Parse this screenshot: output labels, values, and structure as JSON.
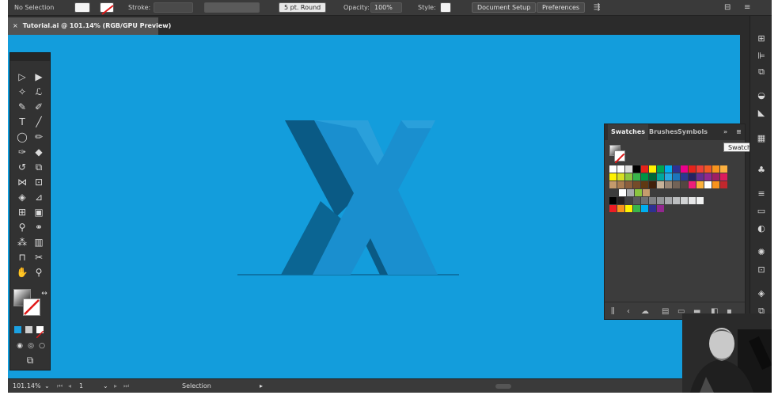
{
  "control_bar": {
    "selection_status": "No Selection",
    "stroke_label": "Stroke:",
    "brush_label": "5 pt. Round",
    "opacity_label": "Opacity:",
    "opacity_value": "100%",
    "style_label": "Style:",
    "document_setup": "Document Setup",
    "preferences": "Preferences"
  },
  "document_tab": {
    "close_glyph": "×",
    "title": "Tutorial.ai @ 101.14% (RGB/GPU Preview)"
  },
  "swatches_panel": {
    "tabs": [
      "Swatches",
      "Brushes",
      "Symbols"
    ],
    "menu_glyph": "≡",
    "collapse_glyph": "»"
  },
  "tooltip": "Swatches",
  "statusbar": {
    "zoom": "101.14%",
    "artboard": "1",
    "tool_name": "Selection"
  },
  "colors": {
    "canvas_bg": "#139ddc",
    "x_face": "#1a8fcf",
    "x_side": "#0b6593",
    "x_dark": "#0a5a85"
  },
  "swatch_rows": [
    [
      "#ffffff",
      "#ffffff",
      "#dcdcdc",
      "#000000",
      "#e5231b",
      "#fff100",
      "#00a651",
      "#00aeef",
      "#2e3192",
      "#ec008c",
      "#e5231b",
      "#ee4036",
      "#f15a24",
      "#f7941d",
      "#fbb040"
    ],
    [
      "#fff200",
      "#d7df23",
      "#8dc63f",
      "#39b54a",
      "#009444",
      "#006838",
      "#00a79d",
      "#27aae1",
      "#1c75bc",
      "#2b3990",
      "#262262",
      "#662d91",
      "#92278f",
      "#9e1f63",
      "#da1c5c"
    ],
    [
      "#c49a6c",
      "#a97c50",
      "#8b5e3c",
      "#754c29",
      "#603913",
      "#42210b",
      "#c7b299",
      "#998675",
      "#736357",
      "#534741",
      "#ed1e79",
      "#fbb03b",
      "#ffffff",
      "#f7931e",
      "#c1272d"
    ],
    [
      "#ffffff",
      "#a7a9ac",
      "#8bc53f",
      "#c69c6d"
    ],
    [
      "#000000",
      "#231f20",
      "#414042",
      "#58595b",
      "#6d6e71",
      "#808285",
      "#939598",
      "#a7a9ac",
      "#bcbec0",
      "#d1d3d4",
      "#e6e7e8",
      "#f1f2f2"
    ],
    [
      "#ed1c24",
      "#f7941d",
      "#fff200",
      "#39b54a",
      "#00aeef",
      "#2e3192",
      "#92278f"
    ]
  ]
}
